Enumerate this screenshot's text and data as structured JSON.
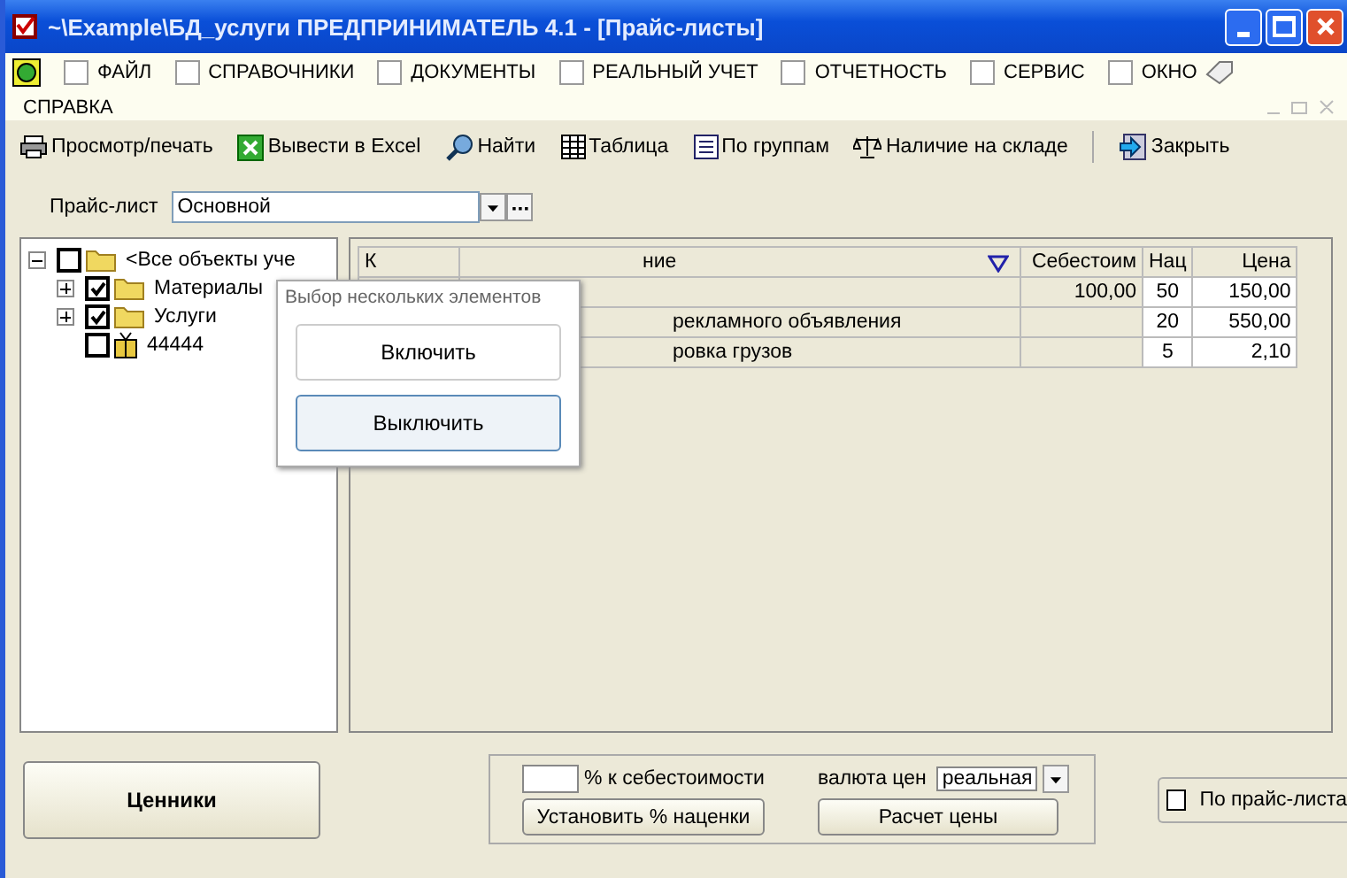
{
  "window": {
    "title": "~\\Example\\БД_услуги  ПРЕДПРИНИМАТЕЛЬ 4.1 - [Прайс-листы]"
  },
  "menu": [
    "ФАЙЛ",
    "СПРАВОЧНИКИ",
    "ДОКУМЕНТЫ",
    "РЕАЛЬНЫЙ УЧЕТ",
    "ОТЧЕТНОСТЬ",
    "СЕРВИС",
    "ОКНО",
    "СПРАВКА"
  ],
  "toolbar": [
    "Просмотр/печать",
    "Вывести в Excel",
    "Найти",
    "Таблица",
    "По группам",
    "Наличие на складе",
    "Закрыть"
  ],
  "price_list": {
    "label": "Прайс-лист",
    "value": "Основной"
  },
  "tree": [
    {
      "label": "<Все объекты уче",
      "checked": false,
      "expanded": true,
      "kind": "folder",
      "children": [
        {
          "label": "Материалы",
          "checked": true,
          "expanded": false,
          "kind": "folder"
        },
        {
          "label": "Услуги",
          "checked": true,
          "expanded": false,
          "kind": "folder"
        },
        {
          "label": "44444",
          "checked": false,
          "kind": "item"
        }
      ]
    }
  ],
  "table": {
    "columns": [
      "К",
      "ние",
      "Себестоим",
      "Нац",
      "Цена"
    ],
    "rows": [
      [
        "",
        "",
        "100,00",
        "50",
        "150,00"
      ],
      [
        "",
        "рекламного объявления",
        "",
        "20",
        "550,00"
      ],
      [
        "",
        "ровка грузов",
        "",
        "5",
        "2,10"
      ]
    ]
  },
  "popup": {
    "title": "Выбор нескольких элементов",
    "buttons": [
      "Включить",
      "Выключить"
    ]
  },
  "bottom": {
    "print_button": "Ценники",
    "percent_label": "% к себестоимости",
    "set_button": "Установить % наценки",
    "currency_label": "валюта цен",
    "currency_value": "реальная",
    "calc_button": "Расчет цены",
    "by_lists": {
      "label": "По прайс-листа",
      "checked": false
    }
  }
}
